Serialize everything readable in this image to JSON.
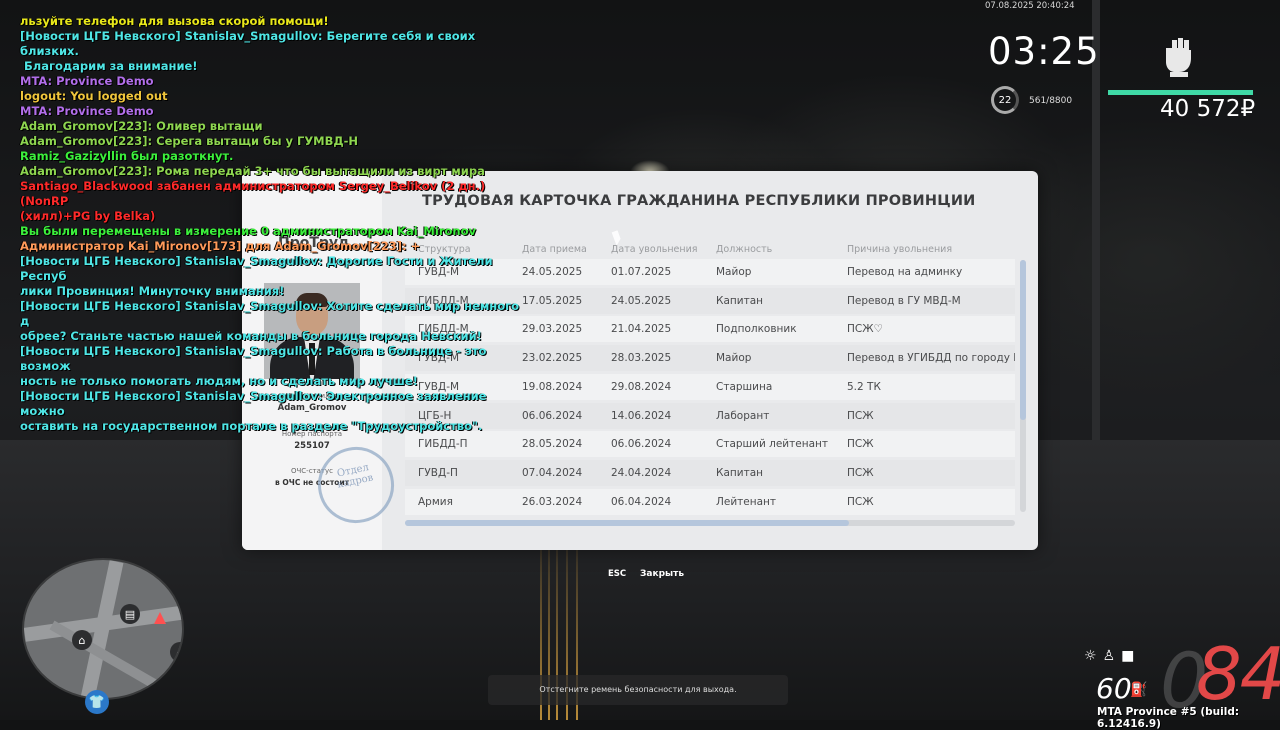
{
  "chat": [
    {
      "text": "льзуйте телефон для вызова скорой помощи!",
      "color": "#e8e81a"
    },
    {
      "text": "[Новости ЦГБ Невского] Stanislav_Smagullov: Берегите себя и своих близких.",
      "color": "#4fe6e6"
    },
    {
      "text": " Благодарим за внимание!",
      "color": "#4fe6e6"
    },
    {
      "text": "MTA: Province Demo",
      "color": "#b26eea"
    },
    {
      "text": "logout: You logged out",
      "color": "#f0c63c"
    },
    {
      "text": "MTA: Province Demo",
      "color": "#b26eea"
    },
    {
      "text": "Adam_Gromov[223]: Оливер вытащи",
      "color": "#8ed650"
    },
    {
      "text": "Adam_Gromov[223]: Серега вытащи бы у ГУМВД-Н",
      "color": "#8ed650"
    },
    {
      "text": "Ramiz_Gazizyllin был разоткнут.",
      "color": "#3cf03c"
    },
    {
      "text": "Adam_Gromov[223]: Рома передай 3+ что бы вытащили из вирт мира",
      "color": "#8ed650"
    },
    {
      "text": "Santiago_Blackwood забанен администратором Sergey_Belikov (2 дн.) (NonRP",
      "color": "#ff2a2a"
    },
    {
      "text": "(хилл)+PG by Belka)",
      "color": "#ff2a2a"
    },
    {
      "text": "Вы были перемещены в измерение 0 администратором Kai_Mironov",
      "color": "#3cf03c"
    },
    {
      "text": "Администратор Kai_Mironov[173] для Adam_Gromov[223]: +",
      "color": "#ff9a5a"
    },
    {
      "text": "[Новости ЦГБ Невского] Stanislav_Smagullov: Дорогие Гости и Жители Респуб",
      "color": "#4fe6e6"
    },
    {
      "text": "лики Провинция! Минуточку внимания!",
      "color": "#4fe6e6"
    },
    {
      "text": "[Новости ЦГБ Невского] Stanislav_Smagullov: Хотите сделать мир немного д",
      "color": "#4fe6e6"
    },
    {
      "text": "обрее? Станьте частью нашей команды в больнице города Невский!",
      "color": "#4fe6e6"
    },
    {
      "text": "[Новости ЦГБ Невского] Stanislav_Smagullov: Работа в больнице - это возмож",
      "color": "#4fe6e6"
    },
    {
      "text": "ность не только помогать людям, но и сделать мир лучше!",
      "color": "#4fe6e6"
    },
    {
      "text": "[Новости ЦГБ Невского] Stanislav_Smagullov: Электронное заявление можно",
      "color": "#4fe6e6"
    },
    {
      "text": "оставить на государственном портале в разделе \"Трудоустройство\".",
      "color": "#4fe6e6"
    }
  ],
  "hud": {
    "timestamp": "07.08.2025 20:40:24",
    "clock": "03:25",
    "level": "22",
    "xp": "561/8800",
    "money": "40 572₽",
    "health_fraction": 1.0,
    "accent": "#3fd9a6"
  },
  "modal": {
    "title": "ТРУДОВАЯ КАРТОЧКА ГРАЖДАНИНА РЕСПУБЛИКИ ПРОВИНЦИИ",
    "brand": "ПроТруд",
    "name_label": "Имя, фамилия",
    "name_value": "Adam_Gromov",
    "passport_label": "Номер паспорта",
    "passport_value": "255107",
    "ochs_label": "ОЧС-статус",
    "ochs_value": "в ОЧС не состоит",
    "stamp_line1": "Отдел",
    "stamp_line2": "кадров",
    "columns": [
      "Структура",
      "Дата приема",
      "Дата увольнения",
      "Должность",
      "Причина увольнения"
    ],
    "rows": [
      [
        "ГУВД-М",
        "24.05.2025",
        "01.07.2025",
        "Майор",
        "Перевод на админку"
      ],
      [
        "ГИБДД-М",
        "17.05.2025",
        "24.05.2025",
        "Капитан",
        "Перевод в ГУ МВД-М"
      ],
      [
        "ГИБДД-М",
        "29.03.2025",
        "21.04.2025",
        "Подполковник",
        "ПСЖ♡"
      ],
      [
        "ГУВД-М",
        "23.02.2025",
        "28.03.2025",
        "Майор",
        "Перевод в УГИБДД по городу Ми"
      ],
      [
        "ГУВД-М",
        "19.08.2024",
        "29.08.2024",
        "Старшина",
        "5.2 ТК"
      ],
      [
        "ЦГБ-Н",
        "06.06.2024",
        "14.06.2024",
        "Лаборант",
        "ПСЖ"
      ],
      [
        "ГИБДД-П",
        "28.05.2024",
        "06.06.2024",
        "Старший лейтенант",
        "ПСЖ"
      ],
      [
        "ГУВД-П",
        "07.04.2024",
        "24.04.2024",
        "Капитан",
        "ПСЖ"
      ],
      [
        "Армия",
        "26.03.2024",
        "06.04.2024",
        "Лейтенант",
        "ПСЖ"
      ]
    ]
  },
  "esc": {
    "key": "ESC",
    "label": "Закрыть"
  },
  "notice": "Отстегните ремень безопасности для выхода.",
  "vehicle": {
    "speed": "84",
    "speed_ghost": "0",
    "fuel": "60",
    "speed_color": "#e24848"
  },
  "build": "MTA Province #5 (build: 6.12416.9)"
}
